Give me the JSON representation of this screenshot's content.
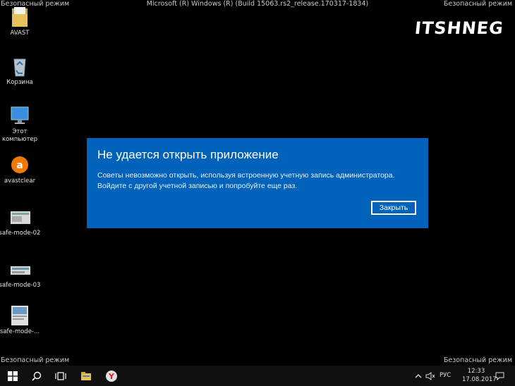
{
  "overlay": {
    "safe_mode": "Безопасный режим",
    "build": "Microsoft (R) Windows (R) (Build 15063.rs2_release.170317-1834)",
    "logo": "ITSHNEG"
  },
  "desktop_icons": [
    {
      "label": "AVAST",
      "icon": "folder-icon"
    },
    {
      "label": "Корзина",
      "icon": "recycle-bin-icon"
    },
    {
      "label": "Этот компьютер",
      "icon": "computer-icon"
    },
    {
      "label": "avastclear",
      "icon": "avast-icon"
    },
    {
      "label": "safe-mode-02",
      "icon": "image-thumbnail-icon"
    },
    {
      "label": "safe-mode-03",
      "icon": "image-thumbnail-icon"
    },
    {
      "label": "safe-mode-...",
      "icon": "image-thumbnail-icon"
    }
  ],
  "dialog": {
    "title": "Не удается открыть приложение",
    "message": "Советы невозможно открыть, используя встроенную учетную запись администратора. Войдите с другой учетной записью и попробуйте еще раз.",
    "close_label": "Закрыть",
    "bg_color": "#0062b8"
  },
  "taskbar": {
    "items": [
      "start-icon",
      "search-icon",
      "task-view-icon",
      "file-explorer-icon",
      "yandex-browser-icon"
    ],
    "tray": {
      "lang": "РУС",
      "time": "12:33",
      "date": "17.08.2017"
    }
  }
}
